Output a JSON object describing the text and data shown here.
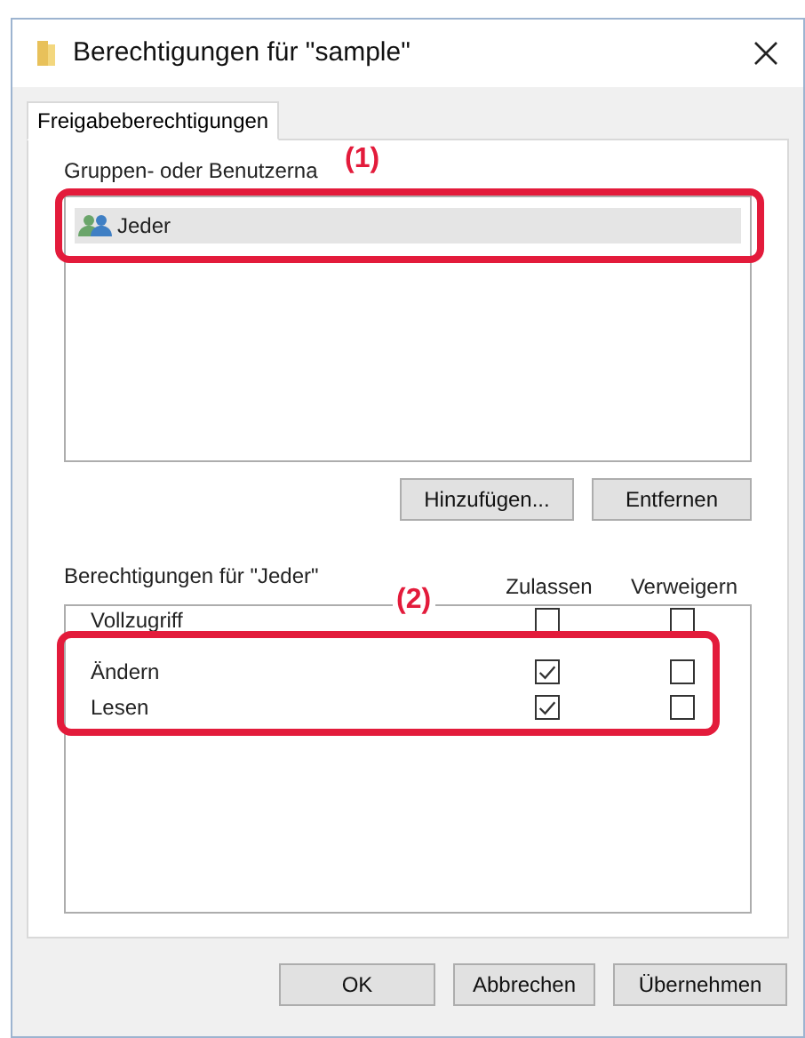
{
  "window": {
    "title": "Berechtigungen für \"sample\""
  },
  "tabs": [
    {
      "label": "Freigabeberechtigungen",
      "selected": true
    }
  ],
  "groups": {
    "label": "Gruppen- oder Benutzerna",
    "items": [
      {
        "name": "Jeder",
        "selected": true
      }
    ]
  },
  "group_buttons": [
    "Hinzufügen...",
    "Entfernen"
  ],
  "permissions": {
    "label": "Berechtigungen für \"Jeder\"",
    "columns": [
      "Zulassen",
      "Verweigern"
    ],
    "rows": [
      {
        "name": "Vollzugriff",
        "allow": false,
        "deny": false
      },
      {
        "name": "Ändern",
        "allow": true,
        "deny": false
      },
      {
        "name": "Lesen",
        "allow": true,
        "deny": false
      }
    ]
  },
  "annotations": [
    {
      "label": "(1)"
    },
    {
      "label": "(2)"
    }
  ],
  "buttons": [
    "OK",
    "Abbrechen",
    "Übernehmen"
  ]
}
